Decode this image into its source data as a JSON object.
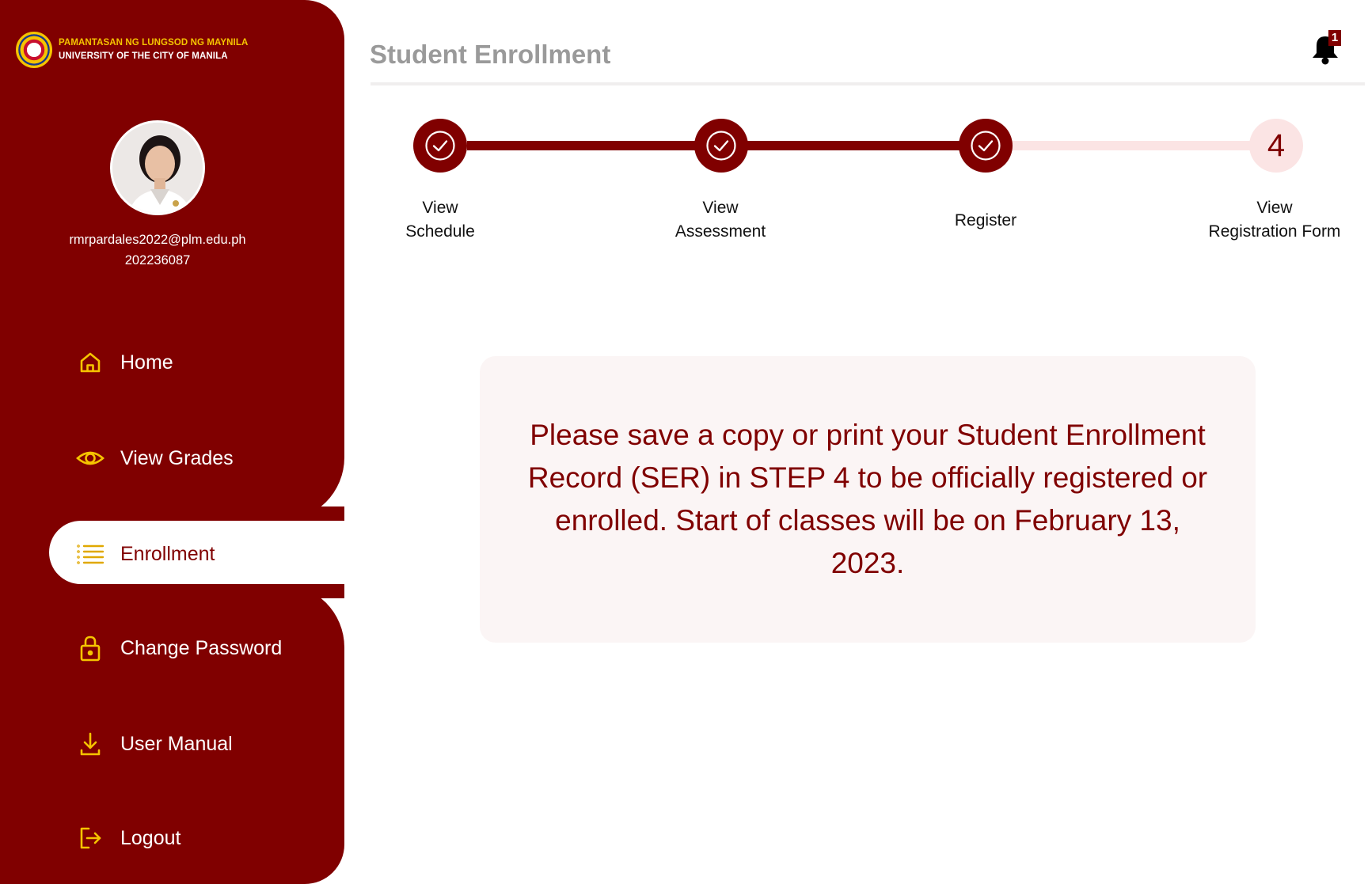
{
  "brand": {
    "line1": "PAMANTASAN NG LUNGSOD NG MAYNILA",
    "line2": "UNIVERSITY OF THE CITY OF MANILA"
  },
  "user": {
    "email": "rmrpardales2022@plm.edu.ph",
    "student_id": "202236087"
  },
  "nav": {
    "items": [
      {
        "label": "Home",
        "icon": "home-icon"
      },
      {
        "label": "View Grades",
        "icon": "eye-icon"
      },
      {
        "label": "Enrollment",
        "icon": "list-icon",
        "active": true
      },
      {
        "label": "Change Password",
        "icon": "lock-icon"
      },
      {
        "label": "User Manual",
        "icon": "download-icon"
      },
      {
        "label": "Logout",
        "icon": "logout-icon"
      }
    ]
  },
  "header": {
    "title": "Student Enrollment",
    "notification_count": "1"
  },
  "stepper": {
    "steps": [
      {
        "line1": "View",
        "line2": "Schedule",
        "status": "done"
      },
      {
        "line1": "View",
        "line2": "Assessment",
        "status": "done"
      },
      {
        "line1": "Register",
        "line2": "",
        "status": "done"
      },
      {
        "line1": "View",
        "line2": "Registration Form",
        "status": "pending",
        "number": "4"
      }
    ]
  },
  "notice": {
    "message": "Please save a copy or print your Student Enrollment Record (SER) in STEP 4 to be officially registered or enrolled. Start of classes will be on February 13, 2023."
  },
  "colors": {
    "primary": "#800000",
    "accent": "#f5c400",
    "step_pending": "#fbe4e4",
    "notice_bg": "#fbf5f5"
  }
}
